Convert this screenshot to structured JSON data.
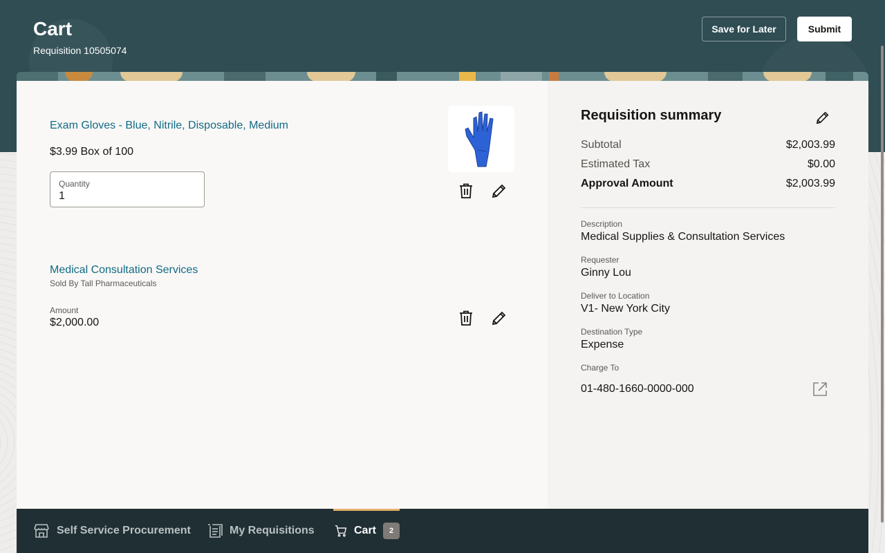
{
  "header": {
    "title": "Cart",
    "subtitle": "Requisition 10505074",
    "save_label": "Save for Later",
    "submit_label": "Submit"
  },
  "cart_items": [
    {
      "title": "Exam Gloves - Blue, Nitrile, Disposable, Medium",
      "price": "$3.99 Box of 100",
      "quantity_label": "Quantity",
      "quantity_value": "1",
      "image_icon": "blue-glove-icon",
      "delete_icon": "trash-icon",
      "edit_icon": "pencil-icon"
    },
    {
      "title": "Medical Consultation Services",
      "seller": "Sold By Tall Pharmaceuticals",
      "amount_label": "Amount",
      "amount_value": "$2,000.00",
      "delete_icon": "trash-icon",
      "edit_icon": "pencil-icon"
    }
  ],
  "summary": {
    "title": "Requisition summary",
    "edit_icon": "pencil-icon",
    "rows": [
      {
        "label": "Subtotal",
        "value": "$2,003.99"
      },
      {
        "label": "Estimated Tax",
        "value": "$0.00"
      },
      {
        "label": "Approval Amount",
        "value": "$2,003.99"
      }
    ],
    "fields": [
      {
        "label": "Description",
        "value": "Medical Supplies & Consultation Services"
      },
      {
        "label": "Requester",
        "value": "Ginny Lou"
      },
      {
        "label": "Deliver to Location",
        "value": "V1- New York City"
      },
      {
        "label": "Destination Type",
        "value": "Expense"
      },
      {
        "label": "Charge To",
        "value": "01-480-1660-0000-000"
      }
    ],
    "charge_to_icon": "external-link-icon"
  },
  "bottom_nav": {
    "items": [
      {
        "label": "Self Service Procurement",
        "icon": "store-icon"
      },
      {
        "label": "My Requisitions",
        "icon": "requisitions-icon"
      },
      {
        "label": "Cart",
        "icon": "cart-icon",
        "badge": "2",
        "active": true
      }
    ]
  },
  "colors": {
    "header_bg": "#2f4d53",
    "link": "#116a86",
    "nav_bg": "#202f33",
    "active_indicator": "#e5b26a"
  }
}
